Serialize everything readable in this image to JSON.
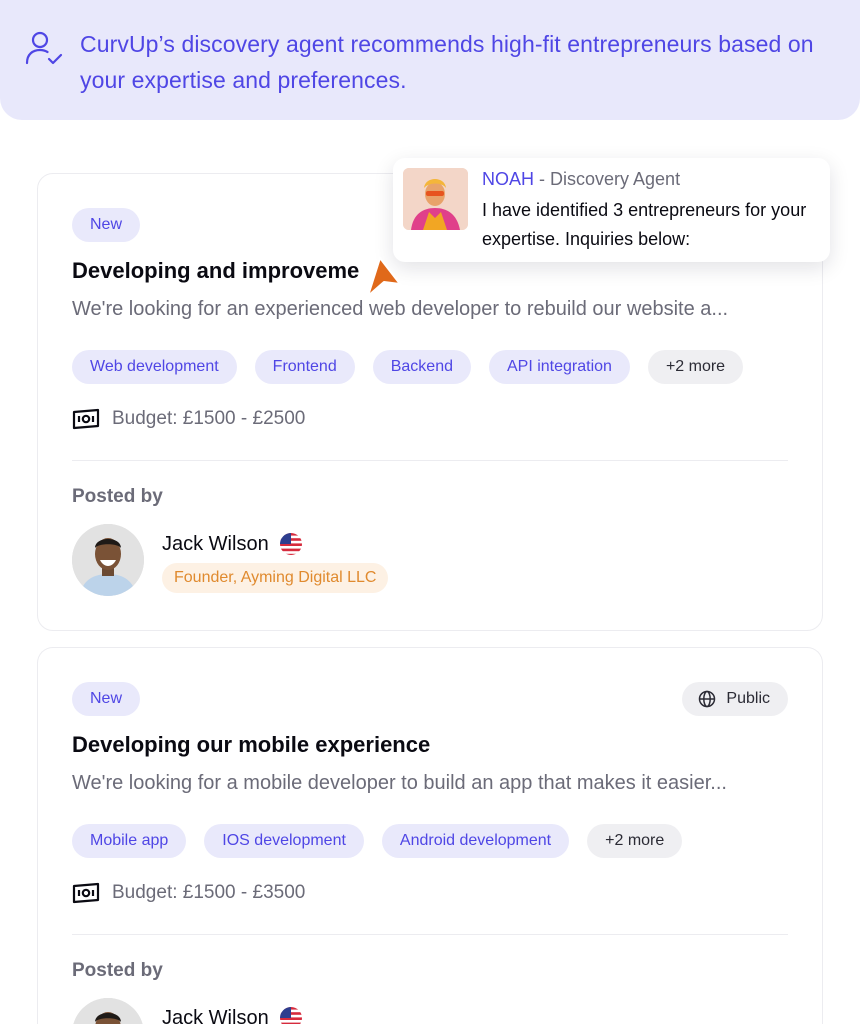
{
  "banner": {
    "text": "CurvUp’s discovery agent recommends high-fit entrepreneurs based on your expertise and preferences.",
    "icon": "user-check-icon"
  },
  "agent": {
    "name": "NOAH",
    "role": " - Discovery Agent",
    "message": "I have identified 3 entrepreneurs for your expertise. Inquiries below:"
  },
  "cards": [
    {
      "badge": "New",
      "title": "Developing and improveme",
      "description": "We're looking for an experienced web developer to rebuild our website a...",
      "tags": [
        "Web development",
        "Frontend",
        "Backend",
        "API integration"
      ],
      "more": "+2 more",
      "budget": "Budget: £1500 - £2500",
      "posted_by_label": "Posted by",
      "person": {
        "name": "Jack Wilson",
        "role": "Founder, Ayming Digital LLC"
      }
    },
    {
      "badge": "New",
      "visibility": "Public",
      "title": "Developing our mobile experience",
      "description": "We're looking for a mobile developer to build an app that makes it  easier...",
      "tags": [
        "Mobile app",
        "IOS development",
        "Android development"
      ],
      "more": "+2 more",
      "budget": "Budget: £1500 - £3500",
      "posted_by_label": "Posted by",
      "person": {
        "name": "Jack Wilson"
      }
    }
  ],
  "colors": {
    "accent": "#4f46e5",
    "banner_bg": "#e8e8fb",
    "tag_bg": "#e9e9fb",
    "role_bg": "#fdf1e4",
    "role_text": "#e08a2e",
    "cursor": "#e0691a"
  }
}
